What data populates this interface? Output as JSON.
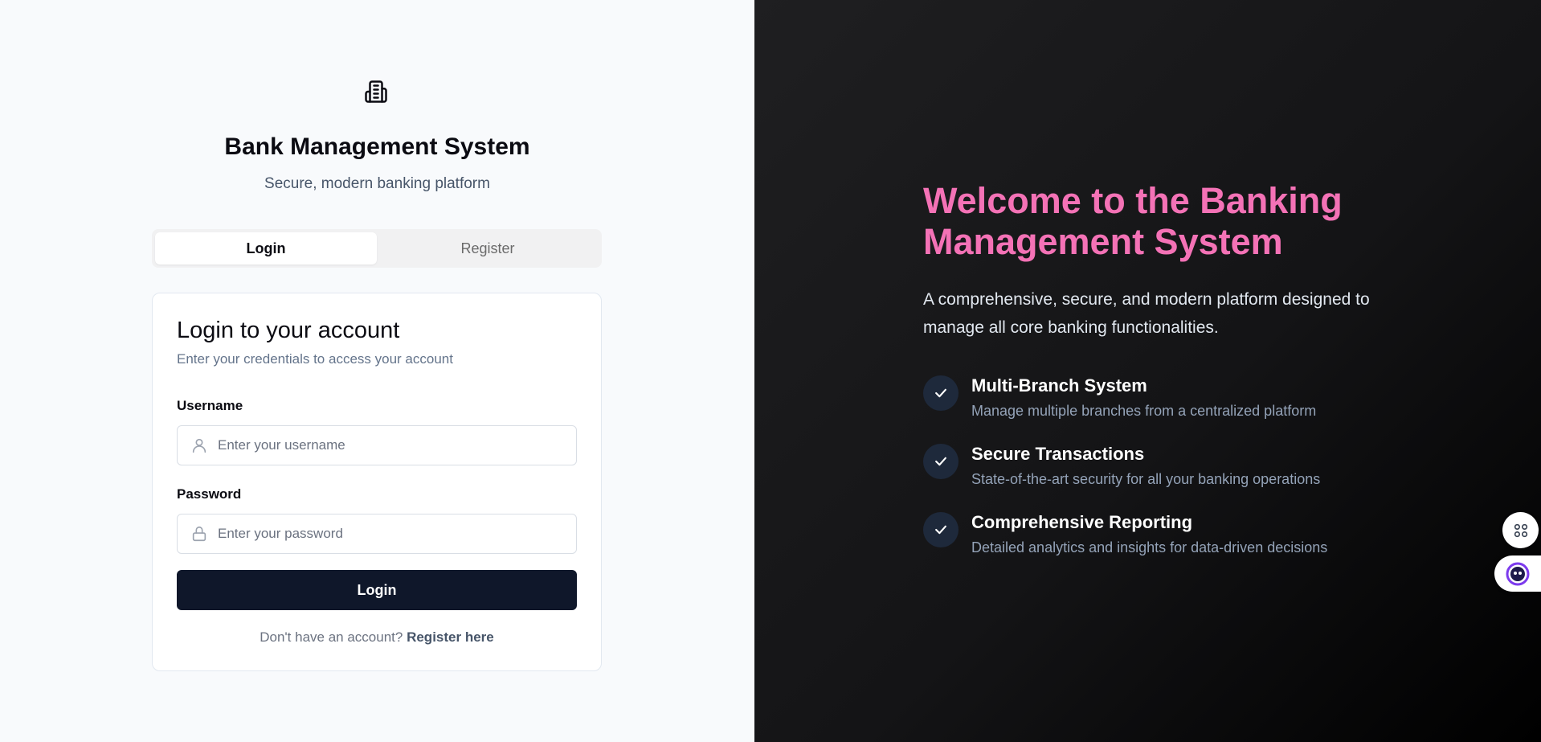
{
  "brand": {
    "icon": "building-icon",
    "title": "Bank Management System",
    "subtitle": "Secure, modern banking platform"
  },
  "tabs": [
    {
      "label": "Login",
      "active": true
    },
    {
      "label": "Register",
      "active": false
    }
  ],
  "login_card": {
    "title": "Login to your account",
    "description": "Enter your credentials to access your account",
    "username_label": "Username",
    "username_placeholder": "Enter your username",
    "username_value": "",
    "username_icon": "user-icon",
    "password_label": "Password",
    "password_placeholder": "Enter your password",
    "password_value": "",
    "password_icon": "lock-icon",
    "submit_label": "Login",
    "footer_text": "Don't have an account?",
    "footer_link": "Register here"
  },
  "hero": {
    "title": "Welcome to the Banking Management System",
    "intro": "A comprehensive, secure, and modern platform designed to manage all core banking functionalities.",
    "features": [
      {
        "title": "Multi-Branch System",
        "description": "Manage multiple branches from a centralized platform"
      },
      {
        "title": "Secure Transactions",
        "description": "State-of-the-art security for all your banking operations"
      },
      {
        "title": "Comprehensive Reporting",
        "description": "Detailed analytics and insights for data-driven decisions"
      }
    ]
  },
  "colors": {
    "accent": "#f472b6",
    "primary_button": "#0f172a",
    "left_bg": "#f8fafc",
    "right_bg": "#141416"
  }
}
